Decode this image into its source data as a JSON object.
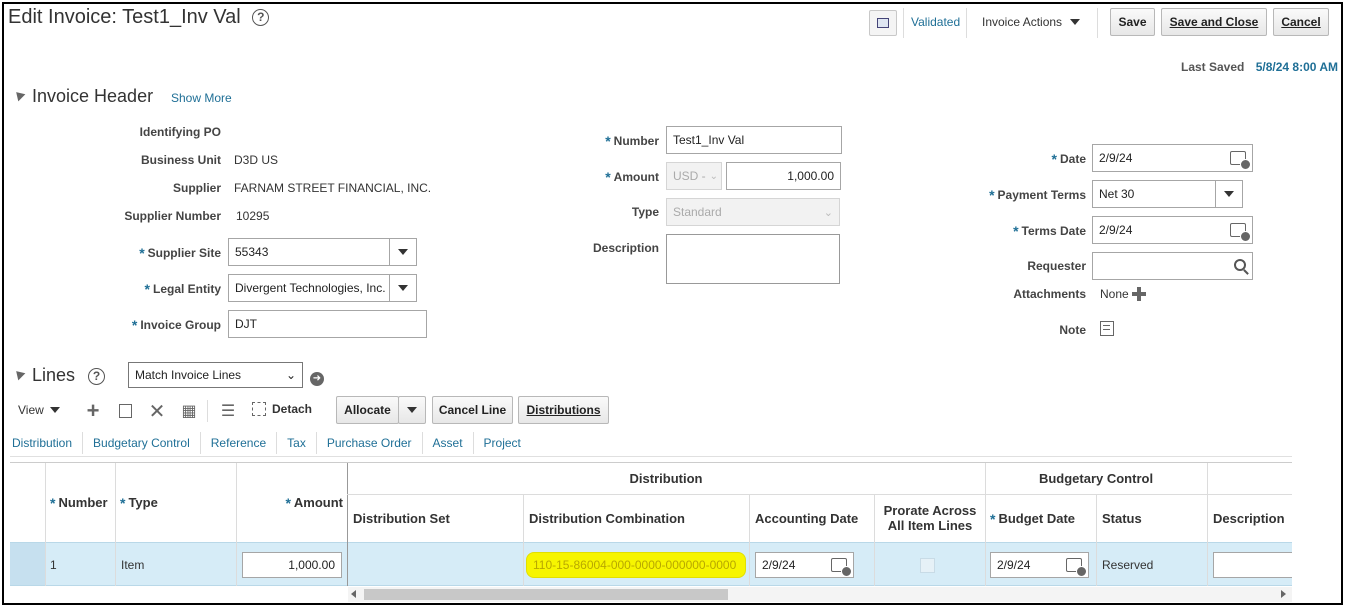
{
  "page": {
    "title": "Edit Invoice: Test1_Inv Val",
    "status_link": "Validated",
    "actions_menu": "Invoice Actions",
    "save": "Save",
    "save_close": "Save and Close",
    "cancel": "Cancel",
    "last_saved_label": "Last Saved",
    "last_saved_value": "5/8/24 8:00 AM"
  },
  "header": {
    "title": "Invoice Header",
    "show_more": "Show More",
    "identifying_po_label": "Identifying PO",
    "business_unit_label": "Business Unit",
    "business_unit": "D3D US",
    "supplier_label": "Supplier",
    "supplier": "FARNAM STREET FINANCIAL, INC.",
    "supplier_number_label": "Supplier Number",
    "supplier_number": "10295",
    "supplier_site_label": "Supplier Site",
    "supplier_site": "55343",
    "legal_entity_label": "Legal Entity",
    "legal_entity": "Divergent Technologies, Inc.",
    "invoice_group_label": "Invoice Group",
    "invoice_group": "DJT",
    "number_label": "Number",
    "number": "Test1_Inv Val",
    "amount_label": "Amount",
    "currency": "USD -",
    "amount": "1,000.00",
    "type_label": "Type",
    "type": "Standard",
    "description_label": "Description",
    "date_label": "Date",
    "date": "2/9/24",
    "payment_terms_label": "Payment Terms",
    "payment_terms": "Net 30",
    "terms_date_label": "Terms Date",
    "terms_date": "2/9/24",
    "requester_label": "Requester",
    "attachments_label": "Attachments",
    "attachments": "None",
    "note_label": "Note"
  },
  "lines": {
    "title": "Lines",
    "match_select": "Match Invoice Lines",
    "view": "View",
    "detach": "Detach",
    "allocate": "Allocate",
    "cancel_line": "Cancel Line",
    "distributions": "Distributions",
    "tabs": [
      "Distribution",
      "Budgetary Control",
      "Reference",
      "Tax",
      "Purchase Order",
      "Asset",
      "Project"
    ],
    "group_distribution": "Distribution",
    "group_budgetary": "Budgetary Control",
    "columns": {
      "number": "Number",
      "type": "Type",
      "amount": "Amount",
      "distribution_set": "Distribution Set",
      "distribution_combination": "Distribution Combination",
      "accounting_date": "Accounting Date",
      "prorate": "Prorate Across All Item Lines",
      "budget_date": "Budget Date",
      "status": "Status",
      "description": "Description"
    },
    "row": {
      "number": "1",
      "type": "Item",
      "amount": "1,000.00",
      "distribution_combination": "110-15-86004-000-0000-000000-0000",
      "accounting_date": "2/9/24",
      "budget_date": "2/9/24",
      "status": "Reserved"
    }
  },
  "colors": {
    "link": "#1f6f96",
    "highlight": "#f7f500",
    "selected_row": "#d6ecf7"
  }
}
